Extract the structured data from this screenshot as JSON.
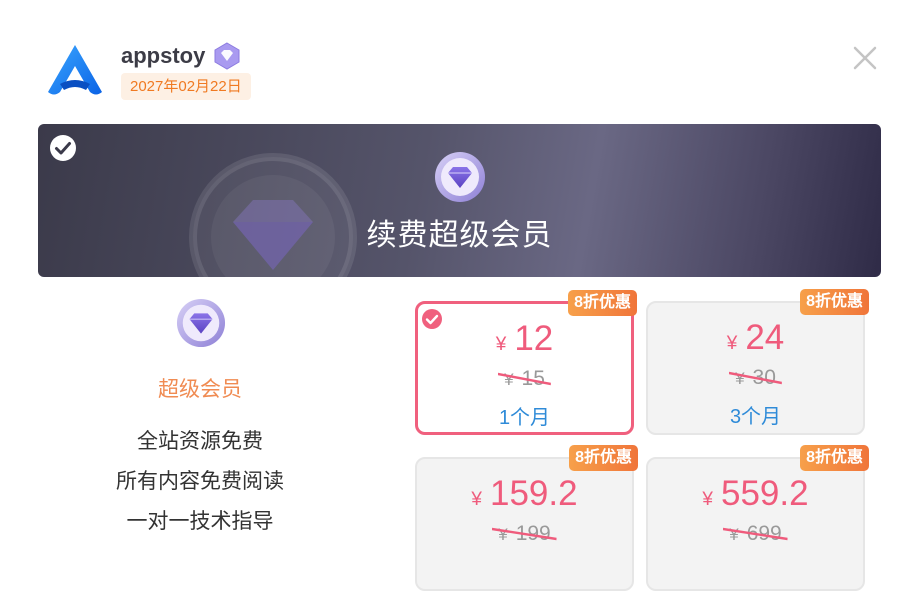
{
  "header": {
    "username": "appstoy",
    "date": "2027年02月22日",
    "icons": {
      "logo": "app-logo-icon",
      "vip": "vip-diamond-badge-icon",
      "close": "close-icon"
    }
  },
  "banner": {
    "title": "续费超级会员",
    "selected": true
  },
  "features": {
    "name": "超级会员",
    "items": [
      "全站资源免费",
      "所有内容免费阅读",
      "一对一技术指导"
    ]
  },
  "plans": [
    {
      "badge": "8折优惠",
      "currency": "¥",
      "price": "12",
      "old_price": "15",
      "duration": "1个月",
      "selected": true
    },
    {
      "badge": "8折优惠",
      "currency": "¥",
      "price": "24",
      "old_price": "30",
      "duration": "3个月",
      "selected": false
    },
    {
      "badge": "8折优惠",
      "currency": "¥",
      "price": "159.2",
      "old_price": "199",
      "duration": "",
      "selected": false
    },
    {
      "badge": "8折优惠",
      "currency": "¥",
      "price": "559.2",
      "old_price": "699",
      "duration": "",
      "selected": false
    }
  ],
  "colors": {
    "accent": "#ef5b7c",
    "badge": "#f0753a",
    "duration": "#2f8bd8",
    "feature_title": "#f08b52"
  }
}
